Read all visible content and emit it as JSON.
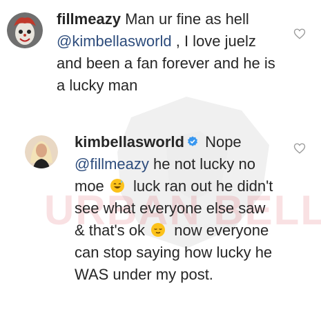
{
  "comments": [
    {
      "username": "fillmeazy",
      "avatar_icon": "clown-avatar",
      "text_before_mention": "Man ur fine as hell",
      "mention": "@kimbellasworld",
      "text_after_mention": ", I love juelz and been a fan forever and he is a lucky man",
      "like_icon": "heart-outline-icon"
    },
    {
      "username": "kimbellasworld",
      "verified": true,
      "avatar_icon": "woman-avatar",
      "text_before_mention": "Nope",
      "mention": "@fillmeazy",
      "text_part_1": "he not lucky no moe",
      "emoji_1": "sweat-smile-emoji",
      "text_part_2": "luck ran out he didn't see what everyone else saw & that's ok",
      "emoji_2": "relieved-face-emoji",
      "text_part_3": "now everyone can stop saying how lucky he WAS under my post.",
      "like_icon": "heart-outline-icon"
    }
  ],
  "watermark": {
    "text": "URBAN BELLE"
  },
  "colors": {
    "text": "#262626",
    "mention": "#2d4c7c",
    "verified": "#3897f0",
    "watermark": "#d6283c"
  }
}
